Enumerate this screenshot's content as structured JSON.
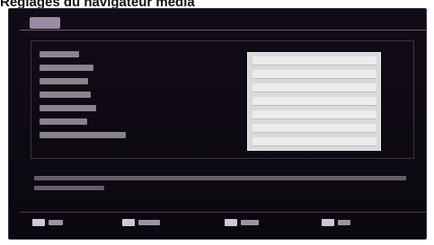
{
  "page": {
    "heading": "Réglages du navigateur média"
  },
  "menu": {
    "title": "",
    "rows": [
      {
        "label": "",
        "value": ""
      },
      {
        "label": "",
        "value": ""
      },
      {
        "label": "",
        "value": ""
      },
      {
        "label": "",
        "value": ""
      },
      {
        "label": "",
        "value": ""
      },
      {
        "label": "",
        "value": ""
      },
      {
        "label": "",
        "value": ""
      }
    ]
  },
  "description": {
    "line1": "",
    "line2": ""
  },
  "softkeys": [
    {
      "name": "softkey-1",
      "label": ""
    },
    {
      "name": "softkey-2",
      "label": ""
    },
    {
      "name": "softkey-3",
      "label": ""
    },
    {
      "name": "softkey-4",
      "label": ""
    }
  ]
}
